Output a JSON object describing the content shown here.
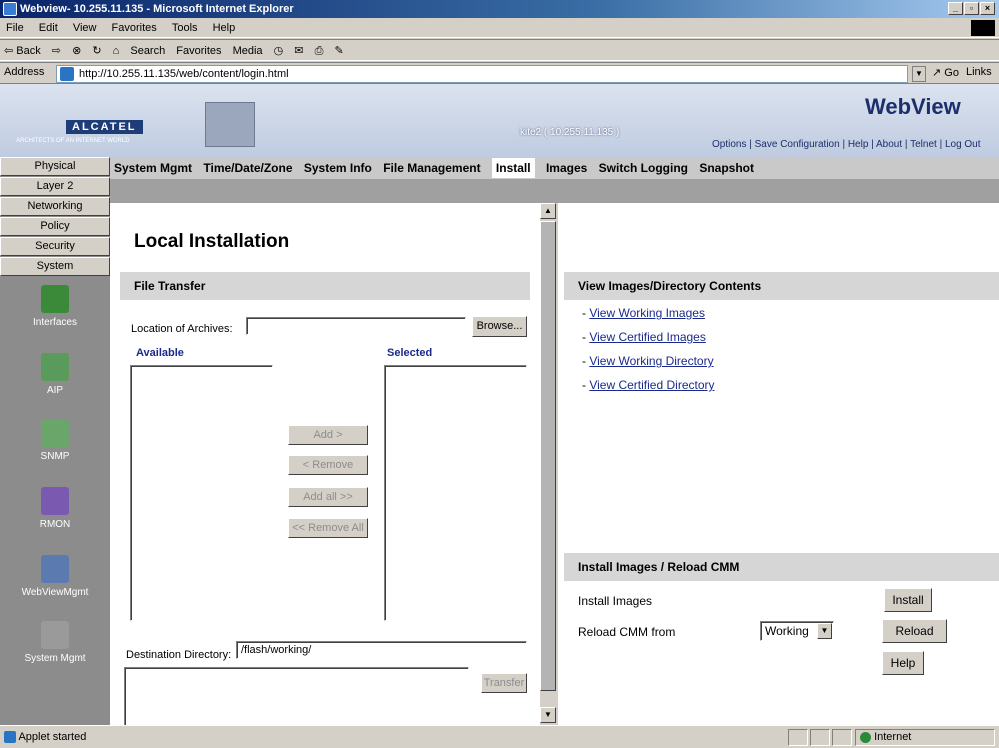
{
  "window": {
    "title": "Webview- 10.255.11.135 - Microsoft Internet Explorer",
    "controls": [
      "_",
      "á",
      "×"
    ]
  },
  "menu": [
    "File",
    "Edit",
    "View",
    "Favorites",
    "Tools",
    "Help"
  ],
  "toolbar": {
    "back": "⇦ Back",
    "forward": "⇨",
    "search": "Search",
    "favorites": "Favorites",
    "media": "Media"
  },
  "address": {
    "label": "Address",
    "url": "http://10.255.11.135/web/content/login.html",
    "go": "Go",
    "links": "Links"
  },
  "banner": {
    "brand": "ALCATEL",
    "tagline": "ARCHITECTS OF AN INTERNET WORLD",
    "host": "kite2 ( 10.255.11.135 )",
    "product": "WebView",
    "links": "Options | Save Configuration | Help | About | Telnet | Log Out"
  },
  "nav": {
    "buttons": [
      "Physical",
      "Layer 2",
      "Networking",
      "Policy",
      "Security",
      "System"
    ],
    "icons": [
      "Interfaces",
      "AIP",
      "SNMP",
      "RMON",
      "WebViewMgmt",
      "System Mgmt"
    ]
  },
  "tabs": [
    "System Mgmt",
    "Time/Date/Zone",
    "System Info",
    "File Management",
    "Install",
    "Images",
    "Switch Logging",
    "Snapshot"
  ],
  "active_tab": "Install",
  "left": {
    "title": "Local Installation",
    "file_transfer": "File Transfer",
    "location_label": "Location of Archives:",
    "location_value": "",
    "browse": "Browse...",
    "available": "Available",
    "selected": "Selected",
    "add": "Add >",
    "remove": "< Remove",
    "add_all": "Add all >>",
    "remove_all": "<< Remove All",
    "dest_label": "Destination Directory:",
    "dest_value": "/flash/working/",
    "transfer": "Transfer"
  },
  "right": {
    "view_head": "View Images/Directory Contents",
    "links": [
      "View Working Images",
      "View Certified Images",
      "View Working Directory",
      "View Certified Directory"
    ],
    "install_head": "Install Images / Reload CMM",
    "install_label": "Install Images",
    "install_btn": "Install",
    "reload_label": "Reload CMM from",
    "reload_select": "Working",
    "reload_btn": "Reload",
    "help_btn": "Help"
  },
  "status": {
    "left": "Applet started",
    "zone": "Internet"
  }
}
